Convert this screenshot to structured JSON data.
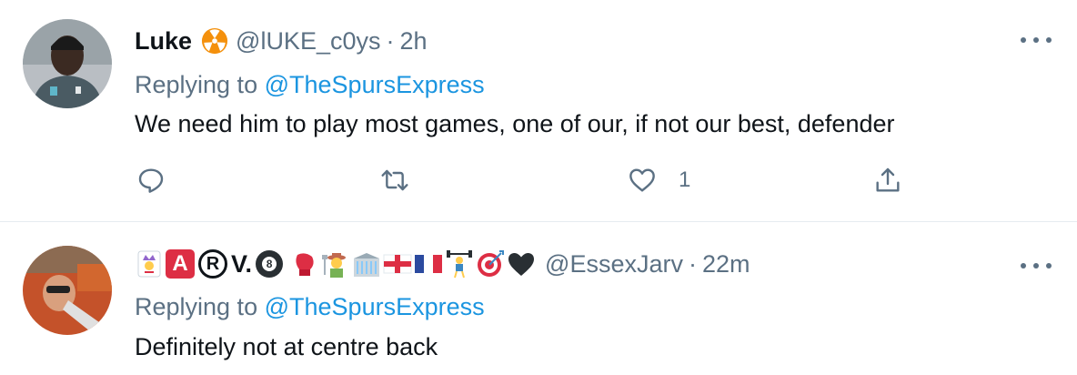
{
  "tweets": [
    {
      "name": "Luke",
      "handle": "@lUKE_c0ys",
      "separator": "·",
      "time": "2h",
      "badge_icon": "radioactive-icon",
      "replying_prefix": "Replying to",
      "replying_to": "@TheSpursExpress",
      "text": "We need him to play most games, one of our, if not our best, defender",
      "actions": {
        "reply_count": "",
        "retweet_count": "",
        "like_count": "1",
        "share_count": ""
      }
    },
    {
      "name_parts": {
        "letter_a": "A",
        "letter_r": "R",
        "v_text": "V.",
        "eight": "8"
      },
      "name_emoji_icons": [
        "joker-icon",
        "letter-a-icon",
        "registered-r-icon",
        "eight-ball-icon",
        "boxing-glove-icon",
        "farmer-icon",
        "classical-building-icon",
        "england-flag-icon",
        "france-flag-icon",
        "weightlifter-icon",
        "direct-hit-icon",
        "black-heart-icon"
      ],
      "handle": "@EssexJarv",
      "separator": "·",
      "time": "22m",
      "replying_prefix": "Replying to",
      "replying_to": "@TheSpursExpress",
      "text": "Definitely not at centre back"
    }
  ],
  "colors": {
    "text_primary": "#0f1419",
    "text_secondary": "#5b7083",
    "link": "#1b95e0",
    "divider": "#e6ecf0"
  }
}
